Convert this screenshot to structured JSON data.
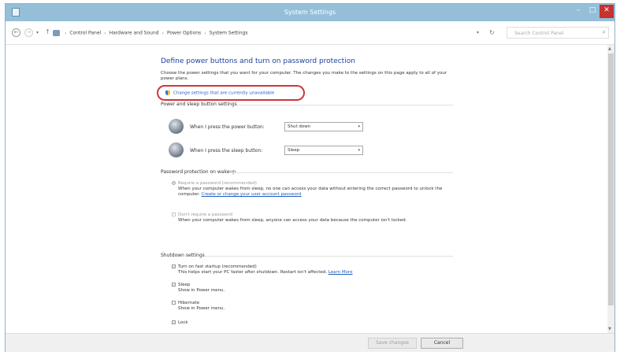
{
  "window": {
    "title": "System Settings"
  },
  "controls": {
    "minimize": "–",
    "maximize": "□",
    "close": "✕"
  },
  "nav": {
    "back": "←",
    "forward": "→",
    "recent": "▾",
    "up": "↑"
  },
  "breadcrumb": [
    "Control Panel",
    "Hardware and Sound",
    "Power Options",
    "System Settings"
  ],
  "breadcrumb_sep": "›",
  "address_dropdown": "▾",
  "refresh": "↻",
  "search": {
    "placeholder": "Search Control Panel",
    "icon": "⌕"
  },
  "main": {
    "heading": "Define power buttons and turn on password protection",
    "description": "Choose the power settings that you want for your computer. The changes you make to the settings on this page apply to all of your power plans.",
    "change_link": "Change settings that are currently unavailable"
  },
  "power_section": {
    "header": "Power and sleep button settings",
    "rows": [
      {
        "label": "When I press the power button:",
        "value": "Shut down"
      },
      {
        "label": "When I press the sleep button:",
        "value": "Sleep"
      }
    ],
    "dropdown_arrow": "▾"
  },
  "password_section": {
    "header": "Password protection on wakeup",
    "require": {
      "title": "Require a password (recommended)",
      "desc": "When your computer wakes from sleep, no one can access your data without entering the correct password to unlock the computer.",
      "link": "Create or change your user account password"
    },
    "dont_require": {
      "title": "Don't require a password",
      "desc": "When your computer wakes from sleep, anyone can access your data because the computer isn't locked."
    }
  },
  "shutdown_section": {
    "header": "Shutdown settings",
    "items": [
      {
        "title": "Turn on fast startup (recommended)",
        "desc": "This helps start your PC faster after shutdown. Restart isn't affected.",
        "link": "Learn More",
        "checked": true
      },
      {
        "title": "Sleep",
        "desc": "Show in Power menu.",
        "checked": true
      },
      {
        "title": "Hibernate",
        "desc": "Show in Power menu.",
        "checked": false
      },
      {
        "title": "Lock",
        "desc": "",
        "checked": true
      }
    ],
    "check_mark": "✓"
  },
  "scrollbar": {
    "up": "▲",
    "down": "▼"
  },
  "footer": {
    "save": "Save changes",
    "cancel": "Cancel"
  },
  "colors": {
    "titlebar": "#95bfd9",
    "heading": "#1e3f9f",
    "link": "#1e5bbf",
    "highlight": "#d0363b",
    "close": "#c7322f"
  }
}
